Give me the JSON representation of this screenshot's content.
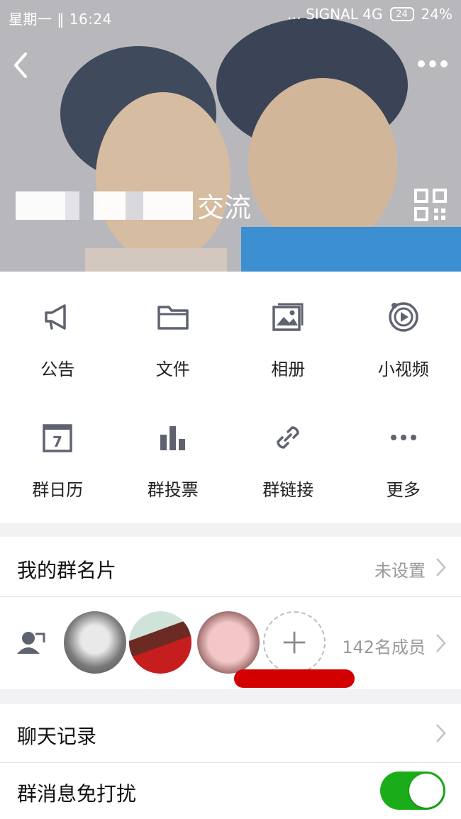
{
  "status_bar": {
    "left_text": "星期一 ‖ 16:24",
    "right_text": "… SIGNAL 4G",
    "battery_level": "24",
    "battery_percent": "24%"
  },
  "header": {
    "group_name_visible": "交流"
  },
  "actions": [
    {
      "label": "公告",
      "icon": "announcement-icon"
    },
    {
      "label": "文件",
      "icon": "folder-icon"
    },
    {
      "label": "相册",
      "icon": "album-icon"
    },
    {
      "label": "小视频",
      "icon": "video-icon"
    },
    {
      "label": "群日历",
      "icon": "calendar-icon"
    },
    {
      "label": "群投票",
      "icon": "vote-icon"
    },
    {
      "label": "群链接",
      "icon": "link-icon"
    },
    {
      "label": "更多",
      "icon": "more-icon"
    }
  ],
  "group_card": {
    "label": "我的群名片",
    "value": "未设置"
  },
  "members": {
    "count_text": "142名成员"
  },
  "chat_history": {
    "label": "聊天记录"
  },
  "do_not_disturb": {
    "label": "群消息免打扰",
    "enabled": true
  },
  "colors": {
    "accent_toggle": "#1aad19",
    "icon_gray": "#5f6370"
  }
}
